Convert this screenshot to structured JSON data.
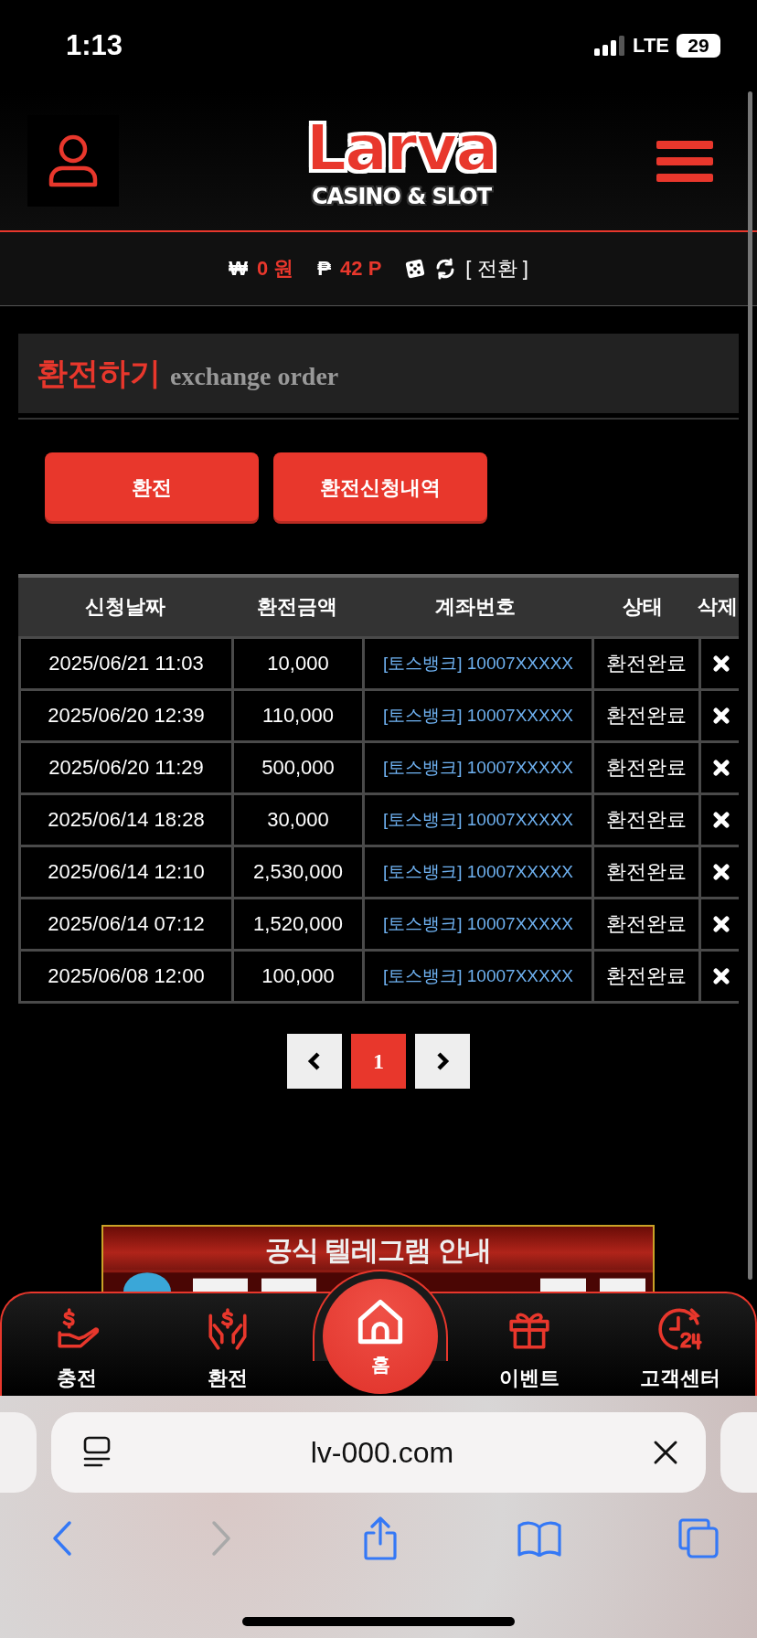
{
  "status_bar": {
    "time": "1:13",
    "network": "LTE",
    "battery": "29"
  },
  "logo": {
    "name": "Larva",
    "tagline": "CASINO & SLOT"
  },
  "balance": {
    "cash_symbol": "₩",
    "cash": "0 원",
    "points_symbol": "₱",
    "points": "42 P",
    "switch": "[ 전환 ]"
  },
  "section": {
    "title": "환전하기",
    "subtitle": "exchange order"
  },
  "actions": [
    {
      "label": "환전"
    },
    {
      "label": "환전신청내역"
    }
  ],
  "table": {
    "columns": [
      "신청날짜",
      "환전금액",
      "계좌번호",
      "상태",
      "삭제"
    ],
    "rows": [
      {
        "date": "2025/06/21 11:03",
        "amount": "10,000",
        "account": "[토스뱅크] 10007XXXXX",
        "status": "환전완료"
      },
      {
        "date": "2025/06/20 12:39",
        "amount": "110,000",
        "account": "[토스뱅크] 10007XXXXX",
        "status": "환전완료"
      },
      {
        "date": "2025/06/20 11:29",
        "amount": "500,000",
        "account": "[토스뱅크] 10007XXXXX",
        "status": "환전완료"
      },
      {
        "date": "2025/06/14 18:28",
        "amount": "30,000",
        "account": "[토스뱅크] 10007XXXXX",
        "status": "환전완료"
      },
      {
        "date": "2025/06/14 12:10",
        "amount": "2,530,000",
        "account": "[토스뱅크] 10007XXXXX",
        "status": "환전완료"
      },
      {
        "date": "2025/06/14 07:12",
        "amount": "1,520,000",
        "account": "[토스뱅크] 10007XXXXX",
        "status": "환전완료"
      },
      {
        "date": "2025/06/08 12:00",
        "amount": "100,000",
        "account": "[토스뱅크] 10007XXXXX",
        "status": "환전완료"
      }
    ]
  },
  "pagination": {
    "pages": [
      {
        "label": "1",
        "selected": true
      }
    ]
  },
  "banner": {
    "title": "공식 텔레그램 안내"
  },
  "bottom_nav": [
    {
      "label": "충전",
      "kind": "charge"
    },
    {
      "label": "환전",
      "kind": "exchange"
    },
    {
      "label": "홈",
      "kind": "home"
    },
    {
      "label": "이벤트",
      "kind": "event"
    },
    {
      "label": "고객센터",
      "kind": "support"
    }
  ],
  "browser": {
    "url": "lv-000.com"
  }
}
